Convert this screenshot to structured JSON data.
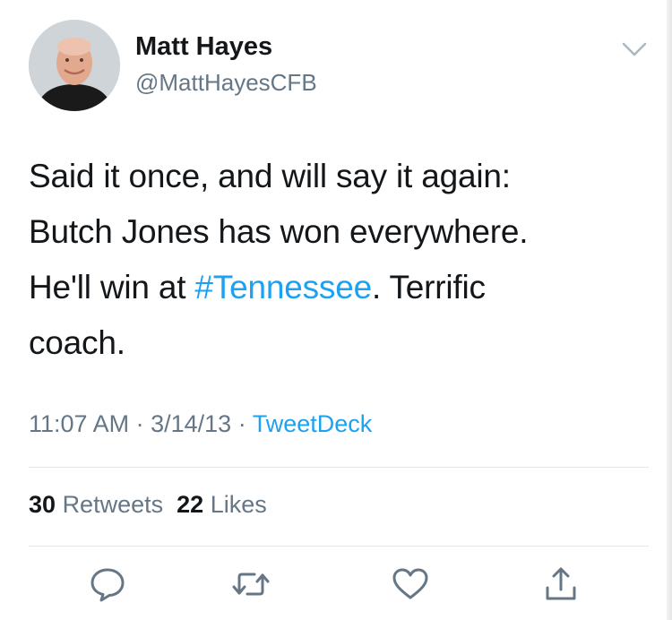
{
  "author": {
    "name": "Matt Hayes",
    "handle": "@MattHayesCFB"
  },
  "tweet": {
    "text_line1": "Said it once, and will say it again:",
    "text_line2": "Butch Jones has won everywhere.",
    "text_line3_prefix": "He'll win at ",
    "hashtag": "#Tennessee",
    "text_line3_suffix": ". Terrific",
    "text_line4": "coach."
  },
  "meta": {
    "time": "11:07 AM",
    "separator": "·",
    "date": "3/14/13",
    "source": "TweetDeck"
  },
  "stats": {
    "retweets_count": "30",
    "retweets_label": "Retweets",
    "likes_count": "22",
    "likes_label": "Likes"
  },
  "actions": {
    "reply_icon": "reply-icon",
    "retweet_icon": "retweet-icon",
    "like_icon": "heart-icon",
    "share_icon": "share-icon"
  },
  "colors": {
    "link": "#1da1f2",
    "secondary_text": "#657786",
    "primary_text": "#14171a",
    "divider": "#e1e8ed"
  }
}
